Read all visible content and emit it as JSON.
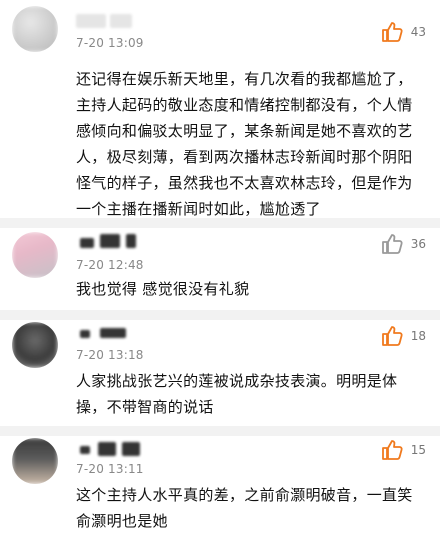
{
  "colors": {
    "like_active": "#f07a1e",
    "like_inactive": "#9a9a9a",
    "time": "#888888"
  },
  "comments": [
    {
      "time": "7-20 13:09",
      "likes": "43",
      "liked": true,
      "text": "还记得在娱乐新天地里，有几次看的我都尴尬了，主持人起码的敬业态度和情绪控制都没有，个人情感倾向和偏驳太明显了，某条新闻是她不喜欢的艺人，极尽刻薄，看到两次播林志玲新闻时那个阴阳怪气的样子，虽然我也不太喜欢林志玲，但是作为一个主播在播新闻时如此，尴尬透了"
    },
    {
      "time": "7-20 12:48",
      "likes": "36",
      "liked": false,
      "text": "我也觉得 感觉很没有礼貌"
    },
    {
      "time": "7-20 13:18",
      "likes": "18",
      "liked": true,
      "text": "人家挑战张艺兴的莲被说成杂技表演。明明是体操，不带智商的说话"
    },
    {
      "time": "7-20 13:11",
      "likes": "15",
      "liked": true,
      "text": "这个主持人水平真的差，之前俞灏明破音，一直笑俞灏明也是她"
    }
  ]
}
